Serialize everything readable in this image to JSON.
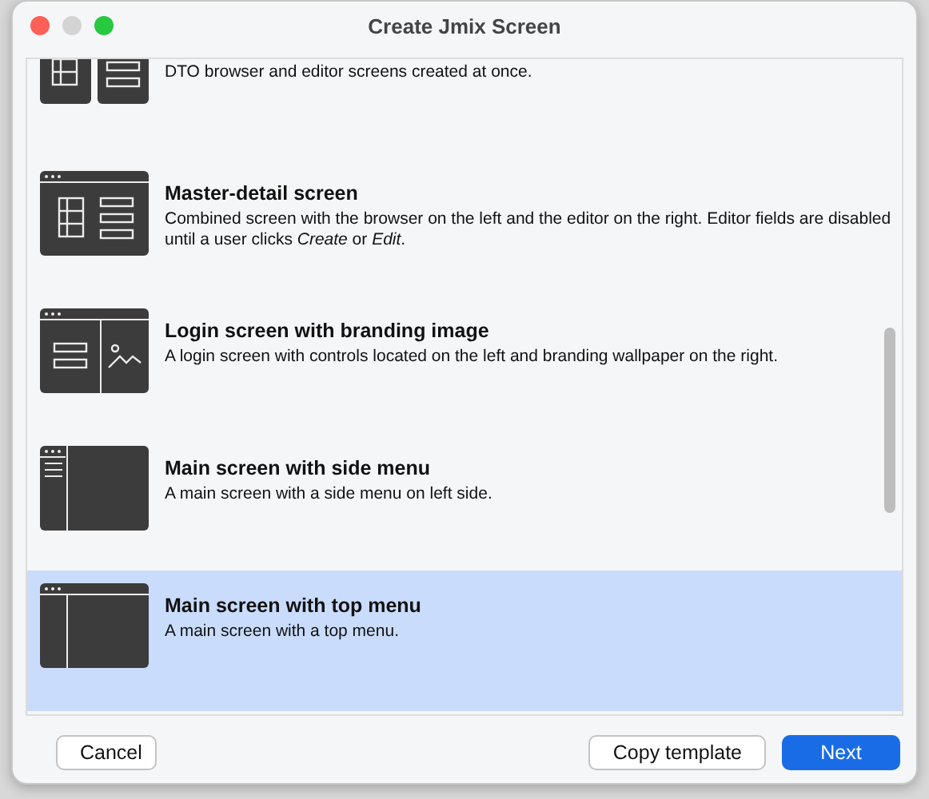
{
  "window": {
    "title": "Create Jmix Screen"
  },
  "templates": [
    {
      "kind": "browser-editor",
      "description": "DTO browser and editor screens created at once.",
      "selected": false
    },
    {
      "kind": "master-detail",
      "title": "Master-detail screen",
      "description": "Combined screen with the browser on the left and the editor on the right. Editor fields are disabled until a user clicks *Create* or *Edit*.",
      "selected": false
    },
    {
      "kind": "login",
      "title": "Login screen with branding image",
      "description": "A login screen with controls located on the left and branding wallpaper on the right.",
      "selected": false
    },
    {
      "kind": "side-menu",
      "title": "Main screen with side menu",
      "description": "A main screen with a side menu on left side.",
      "selected": false
    },
    {
      "kind": "top-menu",
      "title": "Main screen with top menu",
      "description": "A main screen with a top menu.",
      "selected": true
    }
  ],
  "buttons": [
    {
      "label": "Cancel",
      "kind": "secondary"
    },
    {
      "label": "Copy template",
      "kind": "secondary"
    },
    {
      "label": "Next",
      "kind": "primary"
    }
  ]
}
